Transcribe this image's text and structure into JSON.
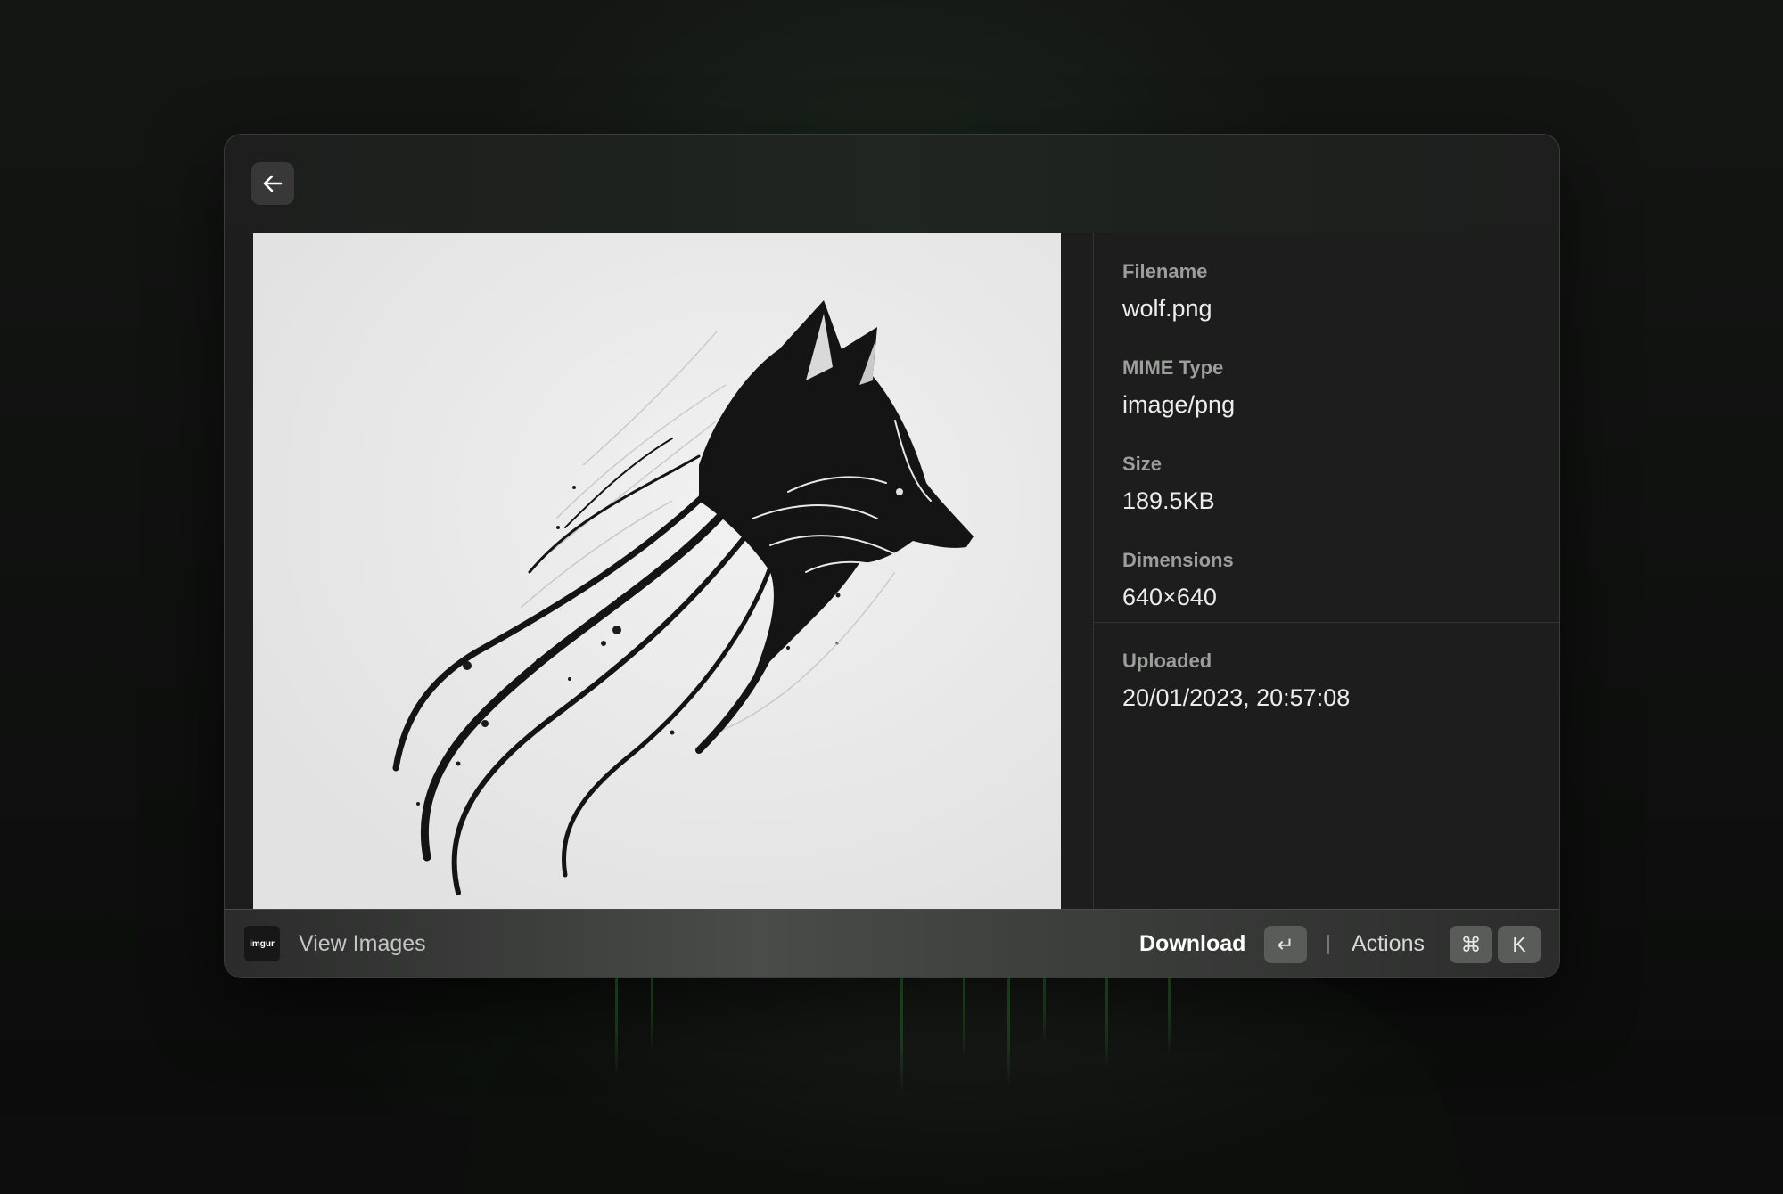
{
  "header": {
    "back_icon": "arrow-left-icon"
  },
  "preview": {
    "image_subject": "wolf ink drawing"
  },
  "metadata": {
    "items": [
      {
        "label": "Filename",
        "value": "wolf.png"
      },
      {
        "label": "MIME Type",
        "value": "image/png"
      },
      {
        "label": "Size",
        "value": "189.5KB"
      },
      {
        "label": "Dimensions",
        "value": "640×640"
      }
    ],
    "uploaded": {
      "label": "Uploaded",
      "value": "20/01/2023, 20:57:08"
    }
  },
  "footer": {
    "app_logo_text": "imgur",
    "app_title": "View Images",
    "primary_action": "Download",
    "primary_shortcut": "↵",
    "actions_label": "Actions",
    "actions_shortcut_mod": "⌘",
    "actions_shortcut_key": "K"
  },
  "colors": {
    "window_bg": "#1c1d1c",
    "accent_green": "#2c8a2e"
  }
}
